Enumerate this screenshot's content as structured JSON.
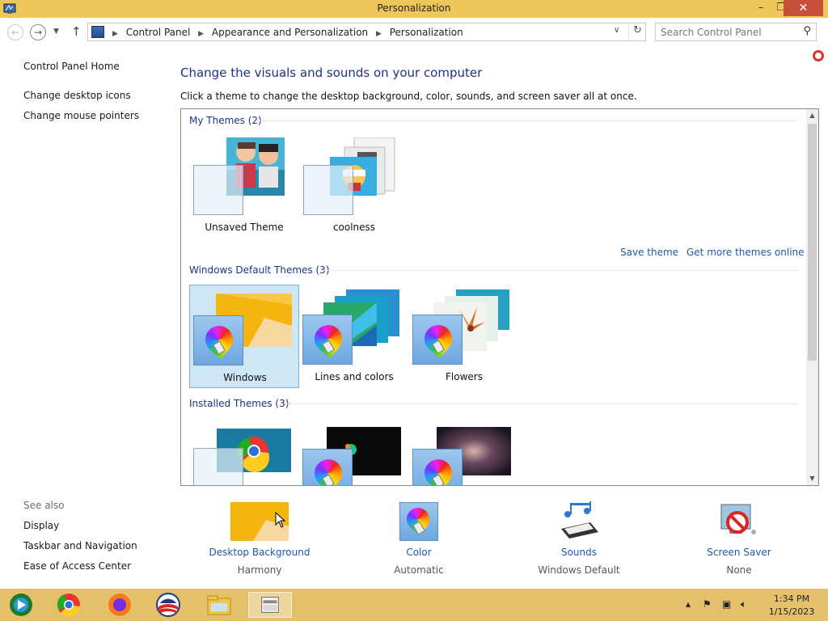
{
  "window": {
    "title": "Personalization",
    "min": "–",
    "max": "❐",
    "close": "✕"
  },
  "nav": {
    "back": "←",
    "forward": "→",
    "up": "↑",
    "breadcrumbs": [
      "Control Panel",
      "Appearance and Personalization",
      "Personalization"
    ],
    "search_placeholder": "Search Control Panel"
  },
  "left": {
    "links": [
      "Control Panel Home",
      "Change desktop icons",
      "Change mouse pointers"
    ],
    "see_also_title": "See also",
    "see_also": [
      "Display",
      "Taskbar and Navigation",
      "Ease of Access Center"
    ]
  },
  "main": {
    "heading": "Change the visuals and sounds on your computer",
    "subtext": "Click a theme to change the desktop background, color, sounds, and screen saver all at once.",
    "groups": {
      "my": {
        "title": "My Themes (2)",
        "items": [
          "Unsaved Theme",
          "coolness"
        ]
      },
      "default": {
        "title": "Windows Default Themes (3)",
        "items": [
          "Windows",
          "Lines and colors",
          "Flowers"
        ]
      },
      "installed": {
        "title": "Installed Themes (3)"
      }
    },
    "save_theme": "Save theme",
    "get_more": "Get more themes online"
  },
  "settings": [
    {
      "label": "Desktop Background",
      "value": "Harmony"
    },
    {
      "label": "Color",
      "value": "Automatic"
    },
    {
      "label": "Sounds",
      "value": "Windows Default"
    },
    {
      "label": "Screen Saver",
      "value": "None"
    }
  ],
  "taskbar": {
    "time": "1:34 PM",
    "date": "1/15/2023"
  },
  "colors": {
    "titlebar": "#efc65a",
    "taskbar": "#e5c06a",
    "link": "#1e5aa8",
    "heading": "#1e3287",
    "selected": "#cfe6f7"
  }
}
